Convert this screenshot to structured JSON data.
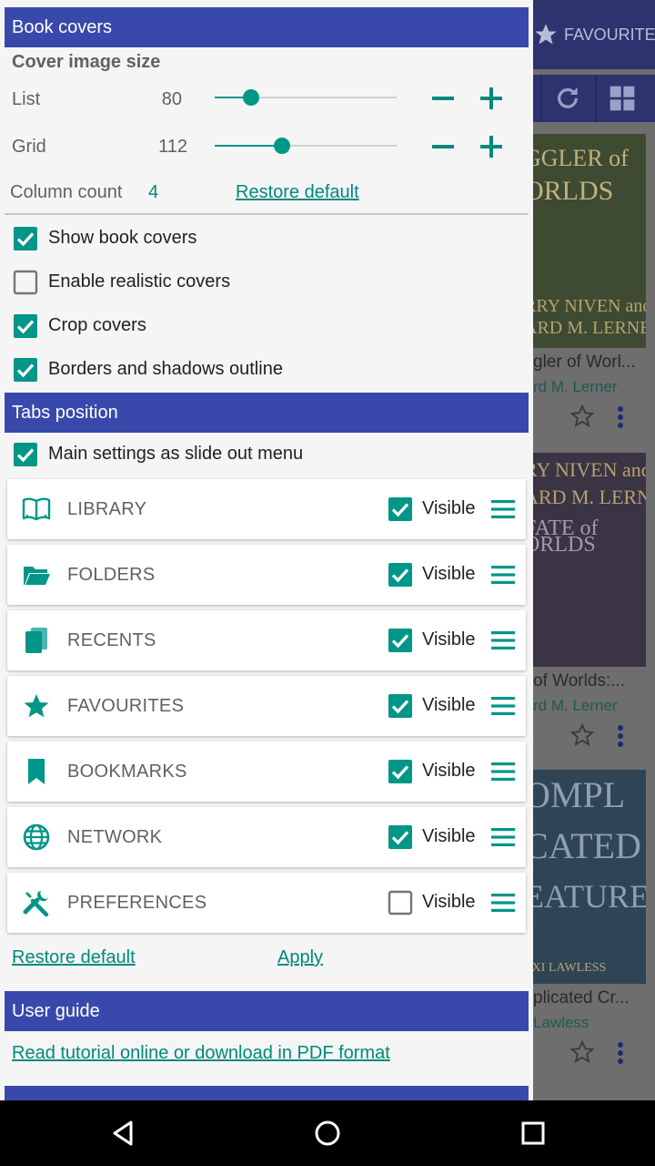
{
  "background": {
    "tab_label": "FAVOURITES",
    "books": [
      {
        "cover_text_1": "GGLER of",
        "cover_text_2": "ORLDS",
        "cover_text_3": "RRY NIVEN and",
        "cover_text_4": "ARD M. LERNER",
        "title": "gler of Worl...",
        "author": "rd M. Lerner"
      },
      {
        "cover_text_1": "RY NIVEN and",
        "cover_text_2": "ARD M. LERNER",
        "cover_text_3": "FATE of",
        "cover_text_4": "ORLDS",
        "title": "of Worlds:...",
        "author": "rd M. Lerner"
      },
      {
        "cover_text_1": "OMPL",
        "cover_text_2": "CATED",
        "cover_text_3": "EATURES",
        "cover_text_4": "EXI LAWLESS",
        "title": "plicated Cr...",
        "author": "Lawless"
      }
    ]
  },
  "book_covers": {
    "header": "Book covers",
    "size_label": "Cover image size",
    "list_label": "List",
    "list_value": "80",
    "list_level": 0.2,
    "grid_label": "Grid",
    "grid_value": "112",
    "grid_level": 0.37,
    "column_count_label": "Column count",
    "column_count_value": "4",
    "restore_default": "Restore default",
    "options": [
      {
        "label": "Show book covers",
        "checked": true
      },
      {
        "label": "Enable realistic covers",
        "checked": false
      },
      {
        "label": "Crop covers",
        "checked": true
      },
      {
        "label": "Borders and shadows outline",
        "checked": true
      }
    ]
  },
  "tabs_position": {
    "header": "Tabs position",
    "slide_out_label": "Main settings as slide out menu",
    "slide_out_checked": true,
    "visible_label": "Visible",
    "tabs": [
      {
        "name": "LIBRARY",
        "icon": "book-open-icon",
        "visible": true
      },
      {
        "name": "FOLDERS",
        "icon": "folder-open-icon",
        "visible": true
      },
      {
        "name": "RECENTS",
        "icon": "recent-books-icon",
        "visible": true
      },
      {
        "name": "FAVOURITES",
        "icon": "star-icon",
        "visible": true
      },
      {
        "name": "BOOKMARKS",
        "icon": "bookmark-icon",
        "visible": true
      },
      {
        "name": "NETWORK",
        "icon": "globe-icon",
        "visible": true
      },
      {
        "name": "PREFERENCES",
        "icon": "tools-icon",
        "visible": false
      }
    ],
    "restore_default": "Restore default",
    "apply": "Apply"
  },
  "user_guide": {
    "header": "User guide",
    "link": "Read tutorial online or download in PDF format"
  },
  "colors": {
    "accent": "#009688",
    "header_bg": "#3949ab"
  }
}
